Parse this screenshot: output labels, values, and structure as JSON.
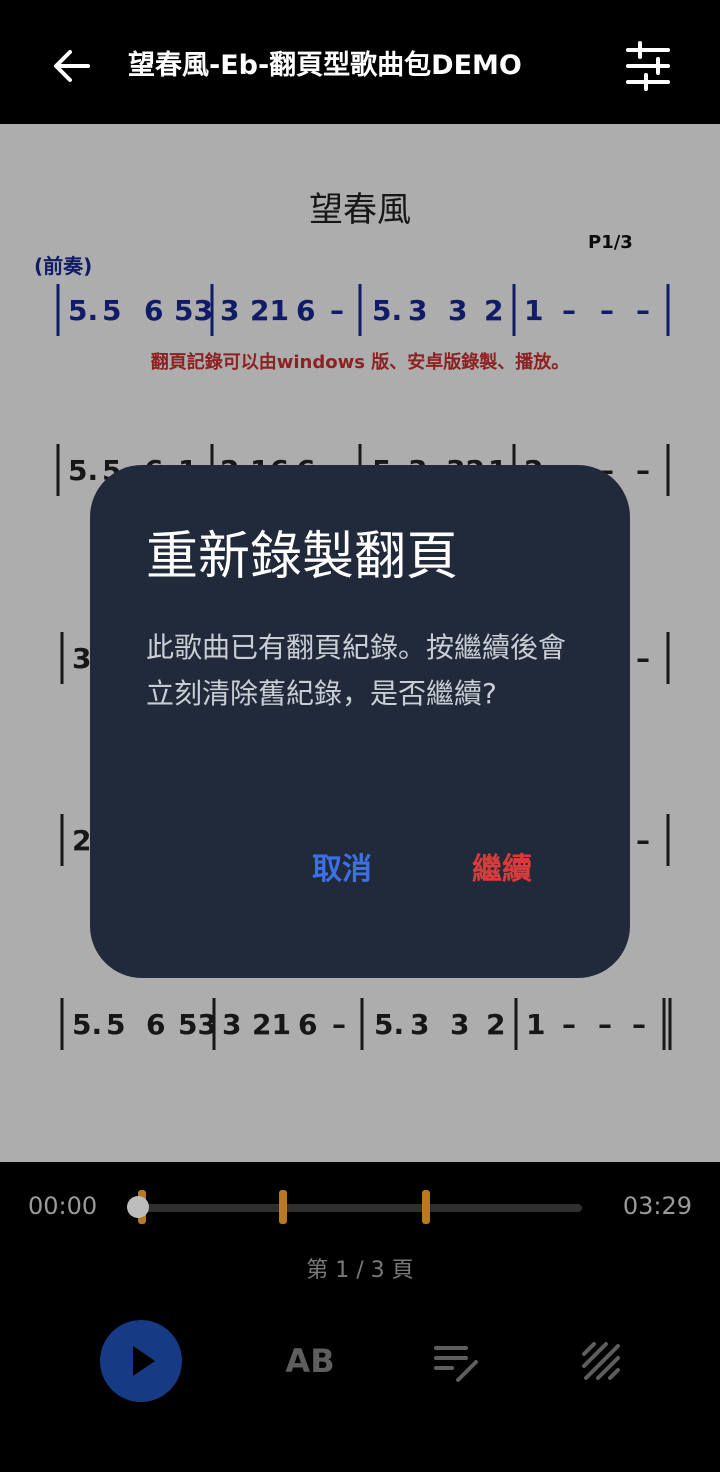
{
  "appbar": {
    "title": "望春風-Eb-翻頁型歌曲包DEMO",
    "back_icon": "arrow-left-icon",
    "tune_icon": "tune-sliders-icon"
  },
  "sheet": {
    "song_title": "望春風",
    "page_label": "P1/3",
    "intro_label": "(前奏)",
    "note_text": "翻頁記錄可以由windows 版、安卓版錄製、播放。",
    "line1": [
      "5.",
      "5",
      "6",
      "53",
      "3",
      "21",
      "6",
      "–",
      "5.",
      "3",
      "3",
      "2",
      "1",
      "–",
      "–",
      "–"
    ],
    "line2": [
      "5.",
      "5",
      "6",
      "1",
      "2",
      "16",
      "6",
      "–",
      "5.",
      "3",
      "32",
      "1",
      "2",
      "–",
      "–",
      "–"
    ],
    "line3": [
      "3",
      "–"
    ],
    "line4": [
      "2",
      "–"
    ],
    "line5": [
      "5.",
      "5",
      "6",
      "53",
      "3",
      "21",
      "6",
      "–",
      "5.",
      "3",
      "3",
      "2",
      "1",
      "–",
      "–",
      "–"
    ]
  },
  "player": {
    "time_start": "00:00",
    "time_end": "03:29",
    "progress": 0.0,
    "markers": [
      0.01,
      0.33,
      0.65
    ],
    "page_indicator": "第 1 / 3 頁",
    "ab_label": "AB",
    "colors": {
      "play": "#163a84",
      "marker": "#b87a1e"
    }
  },
  "dialog": {
    "title": "重新錄製翻頁",
    "message": "此歌曲已有翻頁紀錄。按繼續後會立刻清除舊紀錄，是否繼續?",
    "cancel_label": "取消",
    "continue_label": "繼續",
    "colors": {
      "bg": "#212a3a",
      "cancel": "#3d6fe8",
      "continue": "#d93a3a"
    }
  }
}
